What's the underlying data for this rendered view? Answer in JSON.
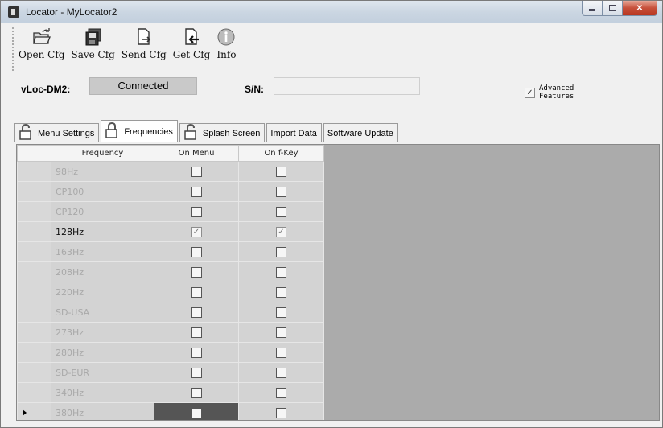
{
  "window": {
    "title": "Locator - MyLocator2"
  },
  "toolbar": {
    "items": [
      {
        "label": "Open Cfg",
        "icon": "open-folder-icon"
      },
      {
        "label": "Save Cfg",
        "icon": "save-icon"
      },
      {
        "label": "Send Cfg",
        "icon": "send-icon"
      },
      {
        "label": "Get Cfg",
        "icon": "get-icon"
      },
      {
        "label": "Info",
        "icon": "info-icon"
      }
    ]
  },
  "status": {
    "device_label": "vLoc-DM2:",
    "connection": "Connected",
    "sn_label": "S/N:",
    "sn_value": "",
    "advanced_label": "Advanced Features",
    "advanced_checked": true
  },
  "tabs": [
    {
      "label": "Menu Settings",
      "icon": "lock-icon",
      "active": false
    },
    {
      "label": "Frequencies",
      "icon": "lock-icon",
      "active": true
    },
    {
      "label": "Splash Screen",
      "icon": "lock-icon",
      "active": false
    },
    {
      "label": "Import Data",
      "active": false
    },
    {
      "label": "Software Update",
      "active": false
    }
  ],
  "grid": {
    "columns": [
      "Frequency",
      "On Menu",
      "On f-Key"
    ],
    "rows": [
      {
        "frequency": "98Hz",
        "on_menu": false,
        "on_fkey": false,
        "enabled": false
      },
      {
        "frequency": "CP100",
        "on_menu": false,
        "on_fkey": false,
        "enabled": false
      },
      {
        "frequency": "CP120",
        "on_menu": false,
        "on_fkey": false,
        "enabled": false
      },
      {
        "frequency": "128Hz",
        "on_menu": true,
        "on_fkey": true,
        "enabled": true
      },
      {
        "frequency": "163Hz",
        "on_menu": false,
        "on_fkey": false,
        "enabled": false
      },
      {
        "frequency": "208Hz",
        "on_menu": false,
        "on_fkey": false,
        "enabled": false
      },
      {
        "frequency": "220Hz",
        "on_menu": false,
        "on_fkey": false,
        "enabled": false
      },
      {
        "frequency": "SD-USA",
        "on_menu": false,
        "on_fkey": false,
        "enabled": false
      },
      {
        "frequency": "273Hz",
        "on_menu": false,
        "on_fkey": false,
        "enabled": false
      },
      {
        "frequency": "280Hz",
        "on_menu": false,
        "on_fkey": false,
        "enabled": false
      },
      {
        "frequency": "SD-EUR",
        "on_menu": false,
        "on_fkey": false,
        "enabled": false
      },
      {
        "frequency": "340Hz",
        "on_menu": false,
        "on_fkey": false,
        "enabled": false
      },
      {
        "frequency": "380Hz",
        "on_menu": false,
        "on_fkey": false,
        "enabled": false,
        "current": true
      }
    ]
  },
  "colors": {
    "grid_background": "#ababab",
    "disabled_text": "#a9a9a9",
    "titlebar": "#cbd6e2",
    "close_button": "#c7503a"
  }
}
